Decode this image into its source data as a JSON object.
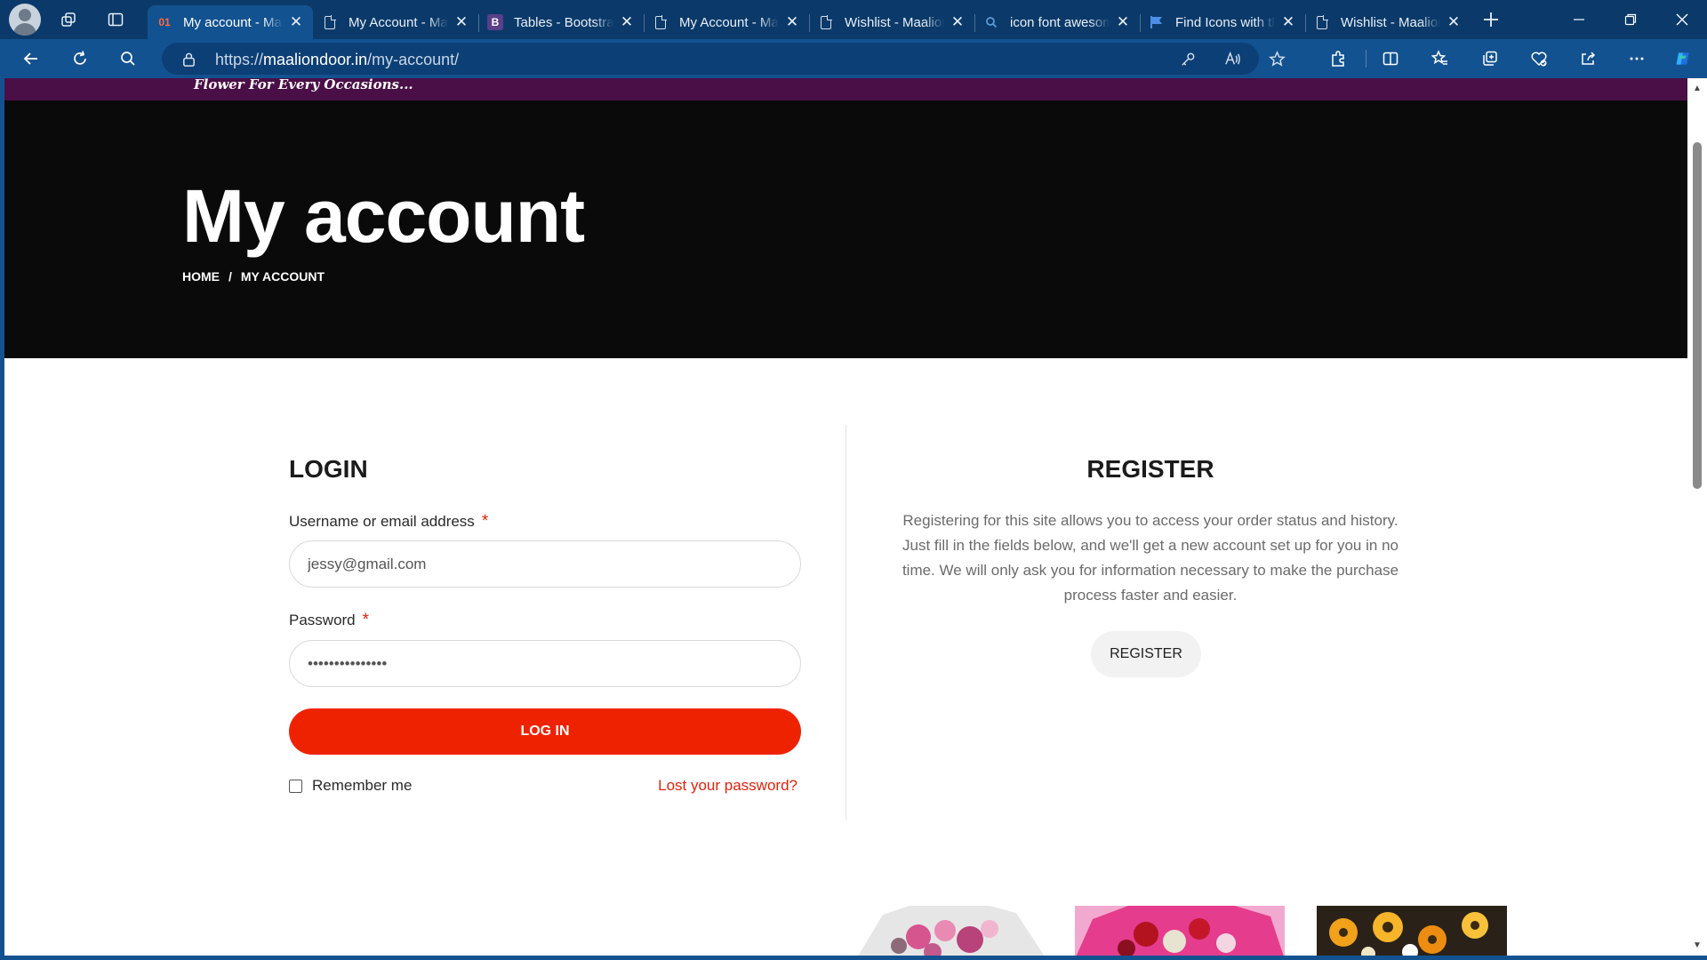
{
  "browser": {
    "tabs": [
      {
        "title": "My account - Maaliondoor",
        "favicon": "site-logo",
        "active": true
      },
      {
        "title": "My Account - Maaliondoor",
        "favicon": "document",
        "active": false
      },
      {
        "title": "Tables - Bootstrap",
        "favicon": "bootstrap",
        "active": false
      },
      {
        "title": "My Account - Maaliondoor",
        "favicon": "document",
        "active": false
      },
      {
        "title": "Wishlist - Maaliondoor",
        "favicon": "document",
        "active": false
      },
      {
        "title": "icon font awesome",
        "favicon": "search",
        "active": false
      },
      {
        "title": "Find Icons with the",
        "favicon": "flag",
        "active": false
      },
      {
        "title": "Wishlist - Maaliondoor",
        "favicon": "document",
        "active": false
      }
    ],
    "tab_favicons": {
      "site": "01",
      "bootstrap": "B"
    },
    "url": {
      "scheme": "https://",
      "host": "maaliondoor.in",
      "path": "/my-account/"
    },
    "colors": {
      "tabbar": "#0b3a6a",
      "toolbar": "#135290"
    }
  },
  "page": {
    "promo_text": "Flower For Every Occasions...",
    "hero_title": "My account",
    "breadcrumb": {
      "home": "HOME",
      "separator": "/",
      "current": "MY ACCOUNT"
    },
    "login": {
      "heading": "LOGIN",
      "username_label": "Username or email address",
      "username_value": "jessy@gmail.com",
      "password_label": "Password",
      "password_value": "•••••••••••••••",
      "required_mark": "*",
      "submit_label": "LOG IN",
      "remember_label": "Remember me",
      "lost_password": "Lost your password?"
    },
    "register": {
      "heading": "REGISTER",
      "text": "Registering for this site allows you to access your order status and history. Just fill in the fields below, and we'll get a new account set up for you in no time. We will only ask you for information necessary to make the purchase process faster and easier.",
      "button_label": "REGISTER"
    },
    "colors": {
      "accent": "#ef2200",
      "promo_bar": "#4a0f47",
      "hero_bg": "#0a0a0a"
    }
  }
}
